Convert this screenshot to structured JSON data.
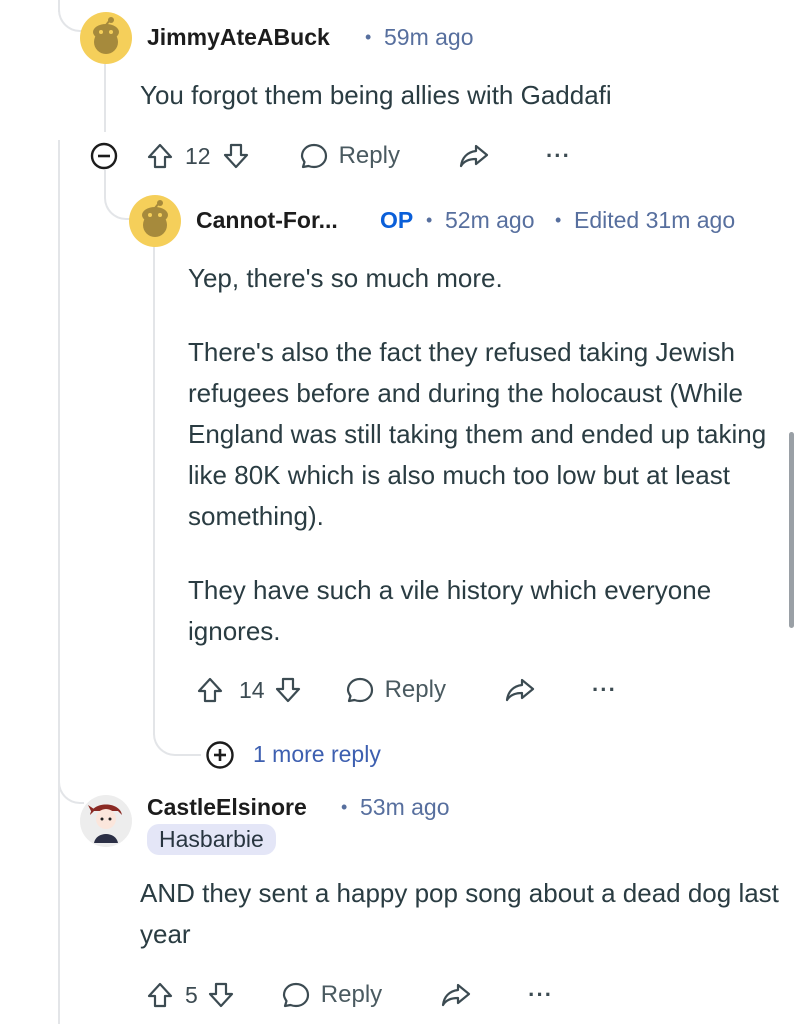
{
  "comments": [
    {
      "username": "JimmyAteABuck",
      "time": "59m ago",
      "body": [
        "You forgot them being allies with Gaddafi"
      ],
      "votes": "12",
      "reply_label": "Reply"
    },
    {
      "username": "Cannot-For...",
      "op_badge": "OP",
      "time": "52m ago",
      "edited": "Edited 31m ago",
      "body": [
        "Yep, there's so much more.",
        "There's also the fact they refused taking Jewish refugees before and during the holocaust (While England was still taking them and ended up taking like 80K which is also much too low but at least something).",
        "They have such a vile history which everyone ignores."
      ],
      "votes": "14",
      "reply_label": "Reply",
      "more_replies": "1 more reply"
    },
    {
      "username": "CastleElsinore",
      "time": "53m ago",
      "flair": "Hasbarbie",
      "body": [
        "AND they sent a happy pop song about a dead dog last year"
      ],
      "votes": "5",
      "reply_label": "Reply"
    }
  ],
  "icons": {
    "upvote": "arrow-up-icon",
    "downvote": "arrow-down-icon",
    "reply": "speech-bubble-icon",
    "share": "share-arrow-icon",
    "more": "ellipsis-icon",
    "collapse": "minus-circle-icon",
    "expand": "plus-circle-icon"
  },
  "colors": {
    "meta": "#576f9e",
    "op": "#0a5fd9",
    "avatar_yellow": "#f5cf5a",
    "flair_bg": "#e4e6f7"
  }
}
